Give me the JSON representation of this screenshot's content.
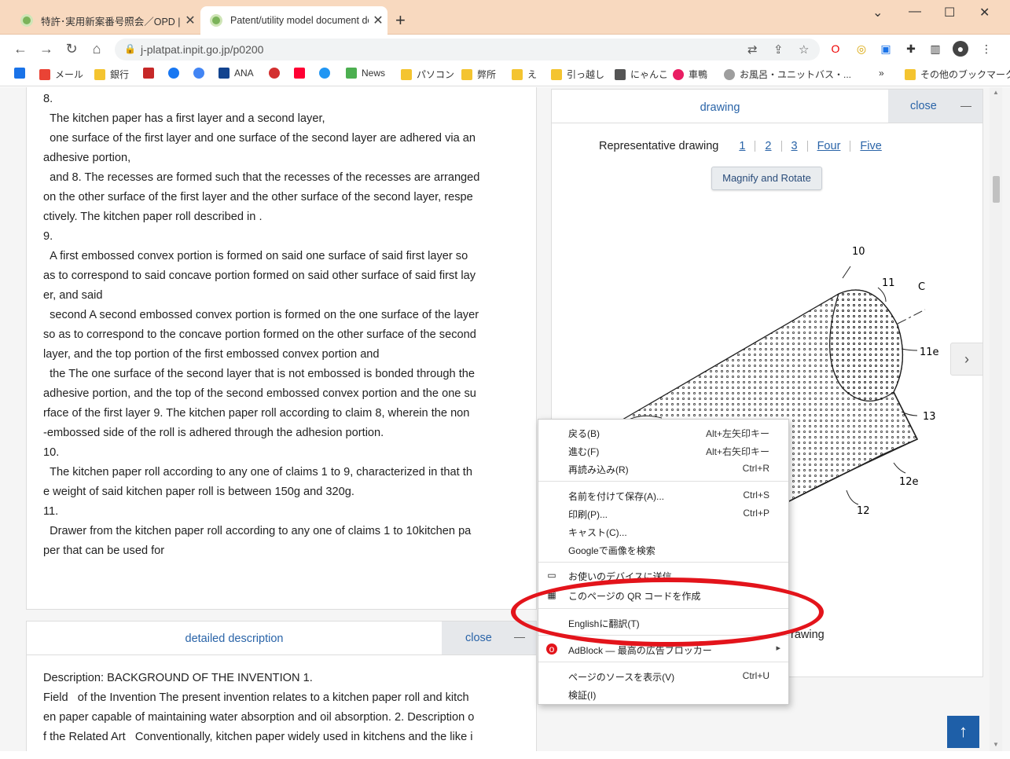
{
  "browser": {
    "tabs": [
      {
        "title": "特許･実用新案番号照会／OPD |",
        "active": false
      },
      {
        "title": "Patent/utility model document de",
        "active": true
      }
    ],
    "url": "j-platpat.inpit.go.jp/p0200",
    "bookmarks": [
      "メール",
      "銀行",
      "ANA",
      "News",
      "パソコン",
      "弊所",
      "え",
      "引っ越し",
      "にゃんこ",
      "車鴨",
      "お風呂・ユニットバス・..."
    ],
    "other_bookmarks": "その他のブックマーク",
    "more": "»"
  },
  "claims": {
    "text": "8.\n  The kitchen paper has a first layer and a second layer,\n  one surface of the first layer and one surface of the second layer are adhered via an\nadhesive portion,\n  and 8. The recesses are formed such that the recesses of the recesses are arranged\non the other surface of the first layer and the other surface of the second layer, respe\nctively. The kitchen paper roll described in .\n9.\n  A first embossed convex portion is formed on said one surface of said first layer so\nas to correspond to said concave portion formed on said other surface of said first lay\ner, and said\n  second A second embossed convex portion is formed on the one surface of the layer\nso as to correspond to the concave portion formed on the other surface of the second\nlayer, and the top portion of the first embossed convex portion and\n  the The one surface of the second layer that is not embossed is bonded through the\nadhesive portion, and the top of the second embossed convex portion and the one su\nrface of the first layer 9. The kitchen paper roll according to claim 8, wherein the non\n-embossed side of the roll is adhered through the adhesion portion.\n10.\n  The kitchen paper roll according to any one of claims 1 to 9, characterized in that th\ne weight of said kitchen paper roll is between 150g and 320g.\n11.\n  Drawer from the kitchen paper roll according to any one of claims 1 to 10kitchen pa\nper that can be used for"
  },
  "detail": {
    "title": "detailed description",
    "close": "close",
    "text": "Description: BACKGROUND OF THE INVENTION 1.\nField   of the Invention The present invention relates to a kitchen paper roll and kitch\nen paper capable of maintaining water absorption and oil absorption. 2. Description o\nf the Related Art   Conventionally, kitchen paper widely used in kitchens and the like i"
  },
  "drawing": {
    "title": "drawing",
    "close": "close",
    "nav_label": "Representative drawing",
    "nav_links": [
      "1",
      "2",
      "3",
      "Four",
      "Five"
    ],
    "magnify": "Magnify and Rotate",
    "caption": "rawing",
    "figure_labels": [
      "10",
      "11",
      "C",
      "11e",
      "13",
      "12e",
      "12"
    ]
  },
  "context_menu": {
    "items": [
      {
        "label": "戻る(B)",
        "shortcut": "Alt+左矢印キー"
      },
      {
        "label": "進む(F)",
        "shortcut": "Alt+右矢印キー"
      },
      {
        "label": "再読み込み(R)",
        "shortcut": "Ctrl+R"
      },
      {
        "label": "名前を付けて保存(A)...",
        "shortcut": "Ctrl+S"
      },
      {
        "label": "印刷(P)...",
        "shortcut": "Ctrl+P"
      },
      {
        "label": "キャスト(C)...",
        "shortcut": ""
      },
      {
        "label": "Googleで画像を検索",
        "shortcut": ""
      },
      {
        "label": "お使いのデバイスに送信",
        "shortcut": ""
      },
      {
        "label": "このページの QR コードを作成",
        "shortcut": ""
      },
      {
        "label": "Englishに翻訳(T)",
        "shortcut": ""
      },
      {
        "label": "AdBlock — 最高の広告ブロッカー",
        "shortcut": ""
      },
      {
        "label": "ページのソースを表示(V)",
        "shortcut": "Ctrl+U"
      },
      {
        "label": "検証(I)",
        "shortcut": ""
      }
    ]
  },
  "colors": {
    "accent": "#2a64a8",
    "highlight_ellipse": "#e3141b",
    "tabstrip": "#f8d9bf"
  }
}
